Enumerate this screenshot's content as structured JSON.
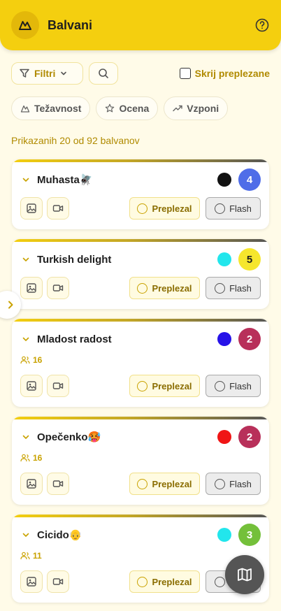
{
  "header": {
    "title": "Balvani"
  },
  "toolbar": {
    "filter_label": "Filtri",
    "hide_label": "Skrij preplezane"
  },
  "sort": [
    {
      "label": "Težavnost",
      "icon": "mountain-icon"
    },
    {
      "label": "Ocena",
      "icon": "star-icon"
    },
    {
      "label": "Vzponi",
      "icon": "trend-icon"
    }
  ],
  "count_text": "Prikazanih 20 od 92 balvanov",
  "labels": {
    "sent": "Preplezal",
    "flash": "Flash"
  },
  "problems": [
    {
      "name": "Muhasta🪰",
      "hold_color": "#111111",
      "grade": "4",
      "grade_color": "#4f6de8",
      "ascents": ""
    },
    {
      "name": "Turkish delight",
      "hold_color": "#22e6ec",
      "grade": "5",
      "grade_color": "#f6e62d",
      "ascents": ""
    },
    {
      "name": "Mladost radost",
      "hold_color": "#2612e8",
      "grade": "2",
      "grade_color": "#b8305a",
      "ascents": "16"
    },
    {
      "name": "Opečenko🥵",
      "hold_color": "#f01515",
      "grade": "2",
      "grade_color": "#b8305a",
      "ascents": "16"
    },
    {
      "name": "Cicido👴",
      "hold_color": "#22e6ec",
      "grade": "3",
      "grade_color": "#74c03a",
      "ascents": "11"
    }
  ]
}
